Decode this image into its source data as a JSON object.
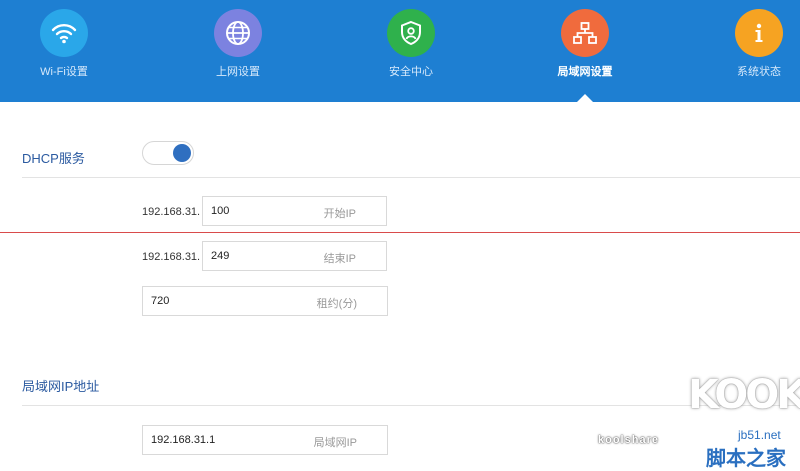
{
  "nav": {
    "items": [
      {
        "label": "Wi-Fi设置",
        "icon": "wifi-icon",
        "color": "#2aa7e9"
      },
      {
        "label": "上网设置",
        "icon": "globe-icon",
        "color": "#7c82e0"
      },
      {
        "label": "安全中心",
        "icon": "shield-icon",
        "color": "#2fb14c"
      },
      {
        "label": "局域网设置",
        "icon": "network-icon",
        "color": "#f06b3d",
        "active": true
      },
      {
        "label": "系统状态",
        "icon": "info-icon",
        "color": "#f6a322"
      }
    ]
  },
  "dhcp": {
    "title": "DHCP服务",
    "enabled": true,
    "start": {
      "prefix": "192.168.31.",
      "value": "100",
      "hint": "开始IP"
    },
    "end": {
      "prefix": "192.168.31.",
      "value": "249",
      "hint": "结束IP"
    },
    "lease": {
      "value": "720",
      "hint": "租约(分)"
    }
  },
  "lan": {
    "title": "局域网IP地址",
    "ip": {
      "value": "192.168.31.1",
      "hint": "局域网IP"
    }
  },
  "watermark": {
    "logo": "KOOK",
    "brand": "koolshare",
    "site": "jb51.net",
    "site_cn": "脚本之家"
  },
  "colors": {
    "nav_bg": "#1e7fd2",
    "toggle_on": "#2f6fc0",
    "section_title": "#2b5aa0"
  }
}
